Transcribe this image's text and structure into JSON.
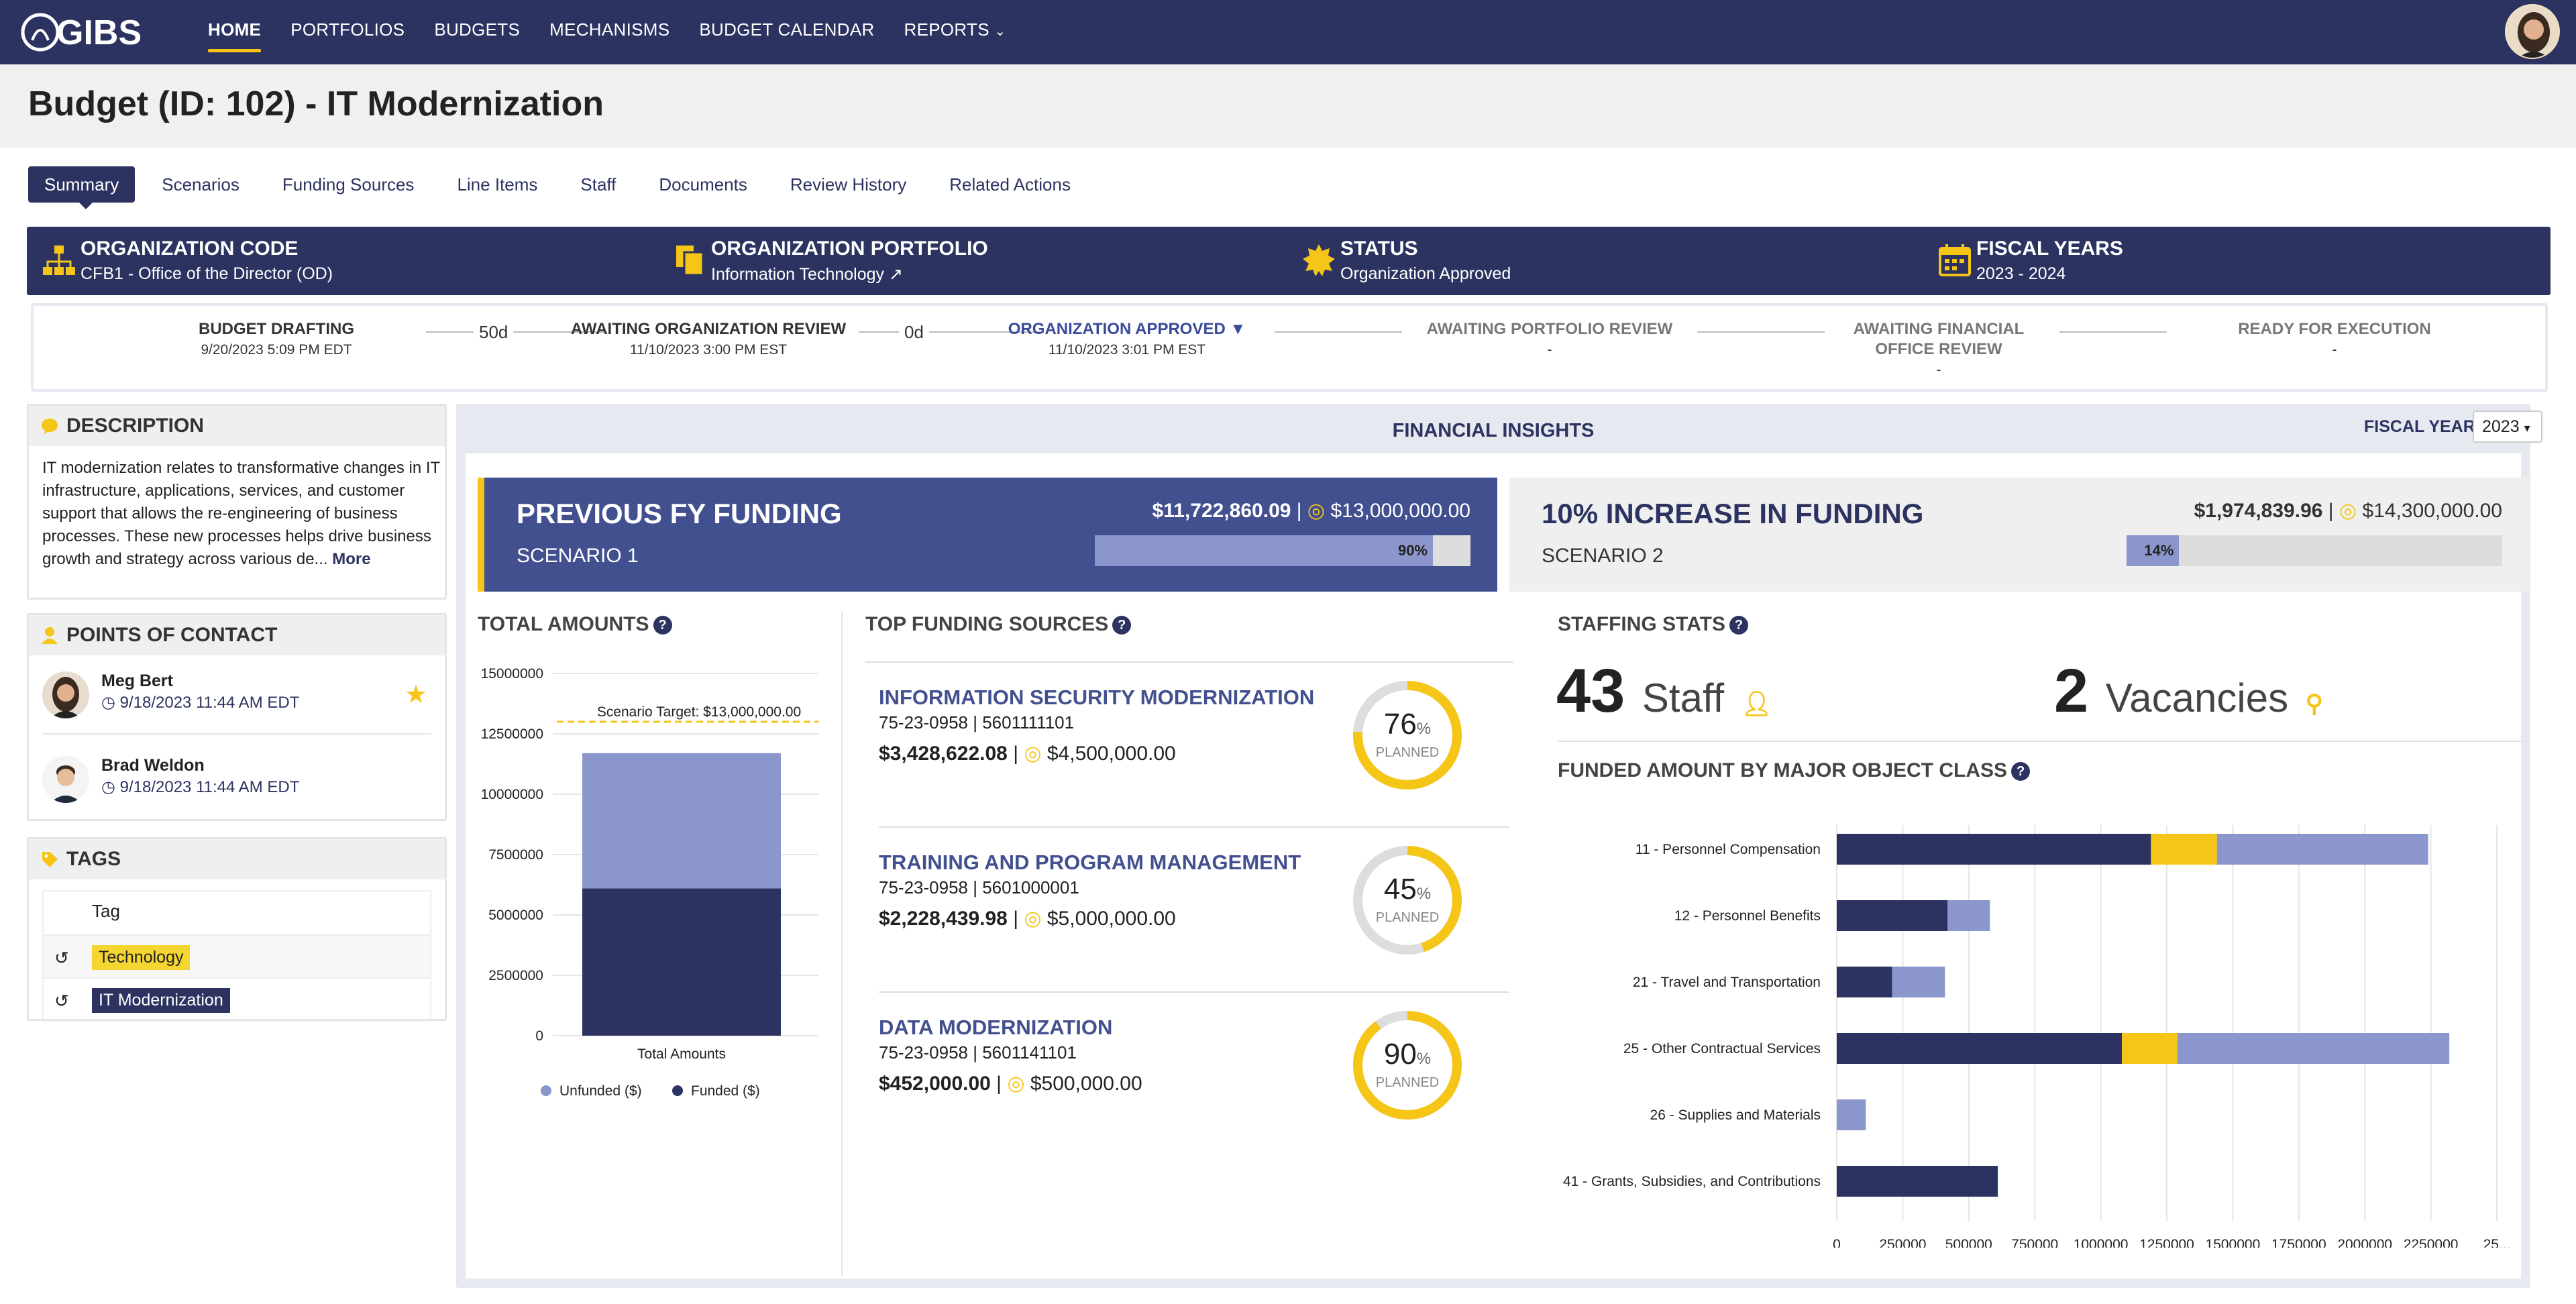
{
  "nav": {
    "logo": "GIBS",
    "items": [
      "HOME",
      "PORTFOLIOS",
      "BUDGETS",
      "MECHANISMS",
      "BUDGET CALENDAR",
      "REPORTS"
    ],
    "active": "HOME"
  },
  "page": {
    "title": "Budget (ID: 102) - IT Modernization"
  },
  "tabs": [
    "Summary",
    "Scenarios",
    "Funding Sources",
    "Line Items",
    "Staff",
    "Documents",
    "Review History",
    "Related Actions"
  ],
  "info": {
    "org_code_label": "ORGANIZATION CODE",
    "org_code_value": "CFB1 - Office of the Director (OD)",
    "portfolio_label": "ORGANIZATION PORTFOLIO",
    "portfolio_value": "Information Technology ↗",
    "status_label": "STATUS",
    "status_value": "Organization Approved",
    "fy_label": "FISCAL YEARS",
    "fy_value": "2023 - 2024"
  },
  "workflow": {
    "steps": [
      {
        "title": "BUDGET DRAFTING",
        "date": "9/20/2023 5:09 PM EDT"
      },
      {
        "title": "AWAITING ORGANIZATION REVIEW",
        "date": "11/10/2023 3:00 PM EST"
      },
      {
        "title": "ORGANIZATION APPROVED ▼",
        "date": "11/10/2023 3:01 PM EST"
      },
      {
        "title": "AWAITING PORTFOLIO REVIEW",
        "date": "-"
      },
      {
        "title": "AWAITING FINANCIAL OFFICE REVIEW",
        "date": "-"
      },
      {
        "title": "READY FOR EXECUTION",
        "date": "-"
      }
    ],
    "durations": [
      "50d",
      "0d"
    ]
  },
  "description": {
    "title": "DESCRIPTION",
    "text": "IT modernization relates to transformative changes in IT infrastructure, applications, services, and customer support that allows the re-engineering of business processes. These new processes helps drive business growth and strategy across various de...",
    "more": "More"
  },
  "contacts": {
    "title": "POINTS OF CONTACT",
    "people": [
      {
        "name": "Meg Bert",
        "time": "9/18/2023 11:44 AM EDT"
      },
      {
        "name": "Brad Weldon",
        "time": "9/18/2023 11:44 AM EDT"
      }
    ]
  },
  "tags": {
    "title": "TAGS",
    "header": "Tag",
    "items": [
      "Technology",
      "IT Modernization"
    ]
  },
  "insights": {
    "title": "FINANCIAL INSIGHTS",
    "fy_label": "FISCAL YEAR",
    "fy_value": "2023",
    "card1": {
      "title": "PREVIOUS FY FUNDING",
      "sub": "SCENARIO 1",
      "funded": "$11,722,860.09",
      "target": "$13,000,000.00",
      "pct": 90,
      "pct_label": "90%"
    },
    "card2": {
      "title": "10% INCREASE IN FUNDING",
      "sub": "SCENARIO 2",
      "funded": "$1,974,839.96",
      "target": "$14,300,000.00",
      "pct": 14,
      "pct_label": "14%"
    }
  },
  "total_amounts": {
    "title": "TOTAL AMOUNTS",
    "target_label": "Scenario Target: $13,000,000.00",
    "x_label": "Total Amounts",
    "legend": [
      "Unfunded ($)",
      "Funded ($)"
    ]
  },
  "top_sources": {
    "title": "TOP FUNDING SOURCES",
    "planned_label": "PLANNED",
    "items": [
      {
        "name": "INFORMATION SECURITY MODERNIZATION",
        "code": "75-23-0958 | 5601111101",
        "funded": "$3,428,622.08",
        "total": "$4,500,000.00",
        "pct": 76,
        "pct_num": "76"
      },
      {
        "name": "TRAINING AND PROGRAM MANAGEMENT",
        "code": "75-23-0958 | 5601000001",
        "funded": "$2,228,439.98",
        "total": "$5,000,000.00",
        "pct": 45,
        "pct_num": "45"
      },
      {
        "name": "DATA MODERNIZATION",
        "code": "75-23-0958 | 5601141101",
        "funded": "$452,000.00",
        "total": "$500,000.00",
        "pct": 90,
        "pct_num": "90"
      }
    ]
  },
  "staffing": {
    "title": "STAFFING STATS",
    "staff": "43",
    "staff_word": "Staff",
    "vacancies": "2",
    "vacancies_word": "Vacancies"
  },
  "object_class": {
    "title": "FUNDED AMOUNT BY MAJOR OBJECT CLASS"
  },
  "colors": {
    "navy": "#2c3360",
    "accent": "#f5c518",
    "light": "#8b96cc"
  },
  "chart_data": [
    {
      "type": "bar",
      "categories": [
        "Total Amounts"
      ],
      "series": [
        {
          "name": "Funded ($)",
          "values": [
            6100000
          ]
        },
        {
          "name": "Unfunded ($)",
          "values": [
            5600000
          ]
        }
      ],
      "stacked": true,
      "ylim": [
        0,
        15000000
      ],
      "yticks": [
        "15000000",
        "12500000",
        "10000000",
        "7500000",
        "5000000",
        "2500000",
        "0"
      ],
      "target": 13000000,
      "annotation": "Scenario Target: $13,000,000.00",
      "legend": [
        "Unfunded ($)",
        "Funded ($)"
      ]
    },
    {
      "type": "bar",
      "orientation": "horizontal",
      "stacked": true,
      "categories": [
        "11 - Personnel Compensation",
        "12 - Personnel Benefits",
        "21 - Travel and Transportation",
        "25 - Other Contractual Services",
        "26 - Supplies and Materials",
        "41 - Grants, Subsidies, and Contributions"
      ],
      "series": [
        {
          "values": [
            1190000,
            420000,
            210000,
            1080000,
            0,
            610000
          ],
          "color": "#2c3360"
        },
        {
          "values": [
            250000,
            0,
            0,
            210000,
            0,
            0
          ],
          "color": "#f5c518"
        },
        {
          "values": [
            800000,
            160000,
            200000,
            1030000,
            110000,
            0
          ],
          "color": "#8b96cc"
        }
      ],
      "xlim": [
        0,
        2500000
      ],
      "xticks": [
        "0",
        "250000",
        "500000",
        "750000",
        "1000000",
        "1250000",
        "1500000",
        "1750000",
        "2000000",
        "2250000",
        "25..."
      ]
    }
  ]
}
